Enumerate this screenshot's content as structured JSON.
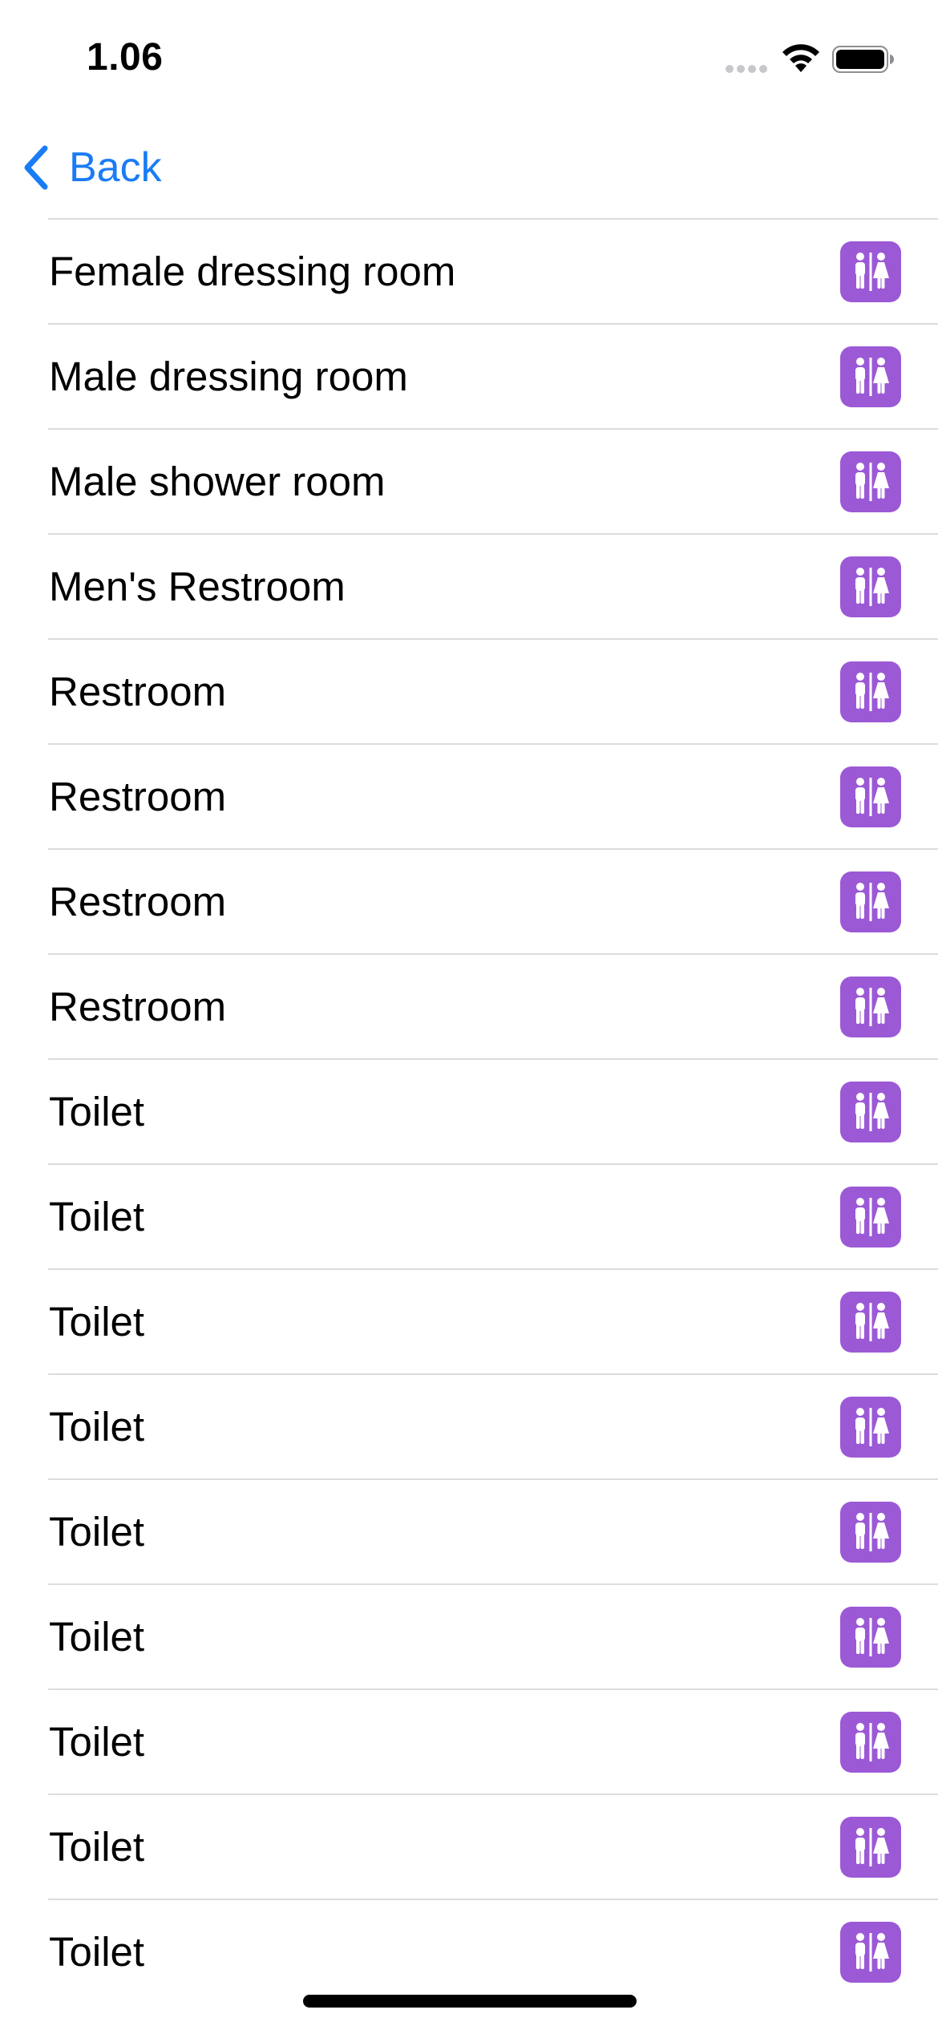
{
  "status_bar": {
    "time": "1.06",
    "icons": [
      "signal-dots-icon",
      "wifi-icon",
      "battery-icon"
    ]
  },
  "nav": {
    "back_label": "Back",
    "accent_color": "#1a7cf5"
  },
  "list": {
    "icon_name": "restroom-icon",
    "icon_color": "#9b59d6",
    "items": [
      {
        "label": "Female dressing room"
      },
      {
        "label": "Male dressing room"
      },
      {
        "label": "Male shower room"
      },
      {
        "label": "Men's Restroom"
      },
      {
        "label": "Restroom"
      },
      {
        "label": "Restroom"
      },
      {
        "label": "Restroom"
      },
      {
        "label": "Restroom"
      },
      {
        "label": "Toilet"
      },
      {
        "label": "Toilet"
      },
      {
        "label": "Toilet"
      },
      {
        "label": "Toilet"
      },
      {
        "label": "Toilet"
      },
      {
        "label": "Toilet"
      },
      {
        "label": "Toilet"
      },
      {
        "label": "Toilet"
      },
      {
        "label": "Toilet"
      }
    ]
  }
}
